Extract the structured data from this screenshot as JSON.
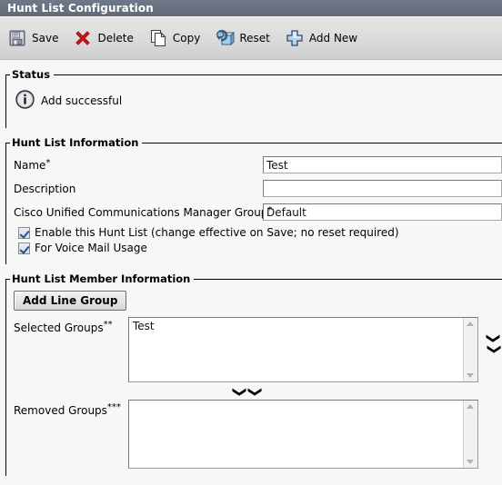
{
  "window": {
    "title": "Hunt List Configuration"
  },
  "toolbar": {
    "buttons": [
      {
        "label": "Save",
        "icon": "floppy-disk-icon"
      },
      {
        "label": "Delete",
        "icon": "red-x-icon"
      },
      {
        "label": "Copy",
        "icon": "copy-pages-icon"
      },
      {
        "label": "Reset",
        "icon": "reset-refresh-icon"
      },
      {
        "label": "Add New",
        "icon": "blue-plus-icon"
      }
    ]
  },
  "status": {
    "legend": "Status",
    "icon": "info-circle-icon",
    "message": "Add successful"
  },
  "hunt_list_information": {
    "legend": "Hunt List Information",
    "fields": [
      {
        "label": "Name",
        "required_marker": "*",
        "value": "Test",
        "placeholder": ""
      },
      {
        "label": "Description",
        "required_marker": "",
        "value": "",
        "placeholder": ""
      },
      {
        "label": "Cisco Unified Communications Manager Group",
        "required_marker": "*",
        "value": "Default",
        "placeholder": ""
      }
    ],
    "checkboxes": [
      {
        "label": "Enable this Hunt List (change effective on Save; no reset required)",
        "checked": true
      },
      {
        "label": "For Voice Mail Usage",
        "checked": true
      }
    ]
  },
  "hunt_list_member_information": {
    "legend": "Hunt List Member Information",
    "add_line_group_label": "Add Line Group",
    "selected_groups": {
      "label": "Selected Groups",
      "required_marker": "**",
      "items": [
        "Test"
      ]
    },
    "removed_groups": {
      "label": "Removed Groups",
      "required_marker": "***",
      "items": []
    },
    "reorder_down_icon": "chevron-down-icon",
    "reorder_up_icon": "chevron-up-icon",
    "move_down_icon": "chevron-down-icon",
    "move_up_icon": "chevron-up-icon"
  },
  "colors": {
    "titlebar": "#69717f",
    "toolbar_top": "#e4e4e4",
    "toolbar_bottom": "#cfcfcf",
    "page_background": "#f7f7f7",
    "checkmark": "#26508f",
    "delete_icon": "#b5121b",
    "accent_blue": "#9cc4e8"
  }
}
